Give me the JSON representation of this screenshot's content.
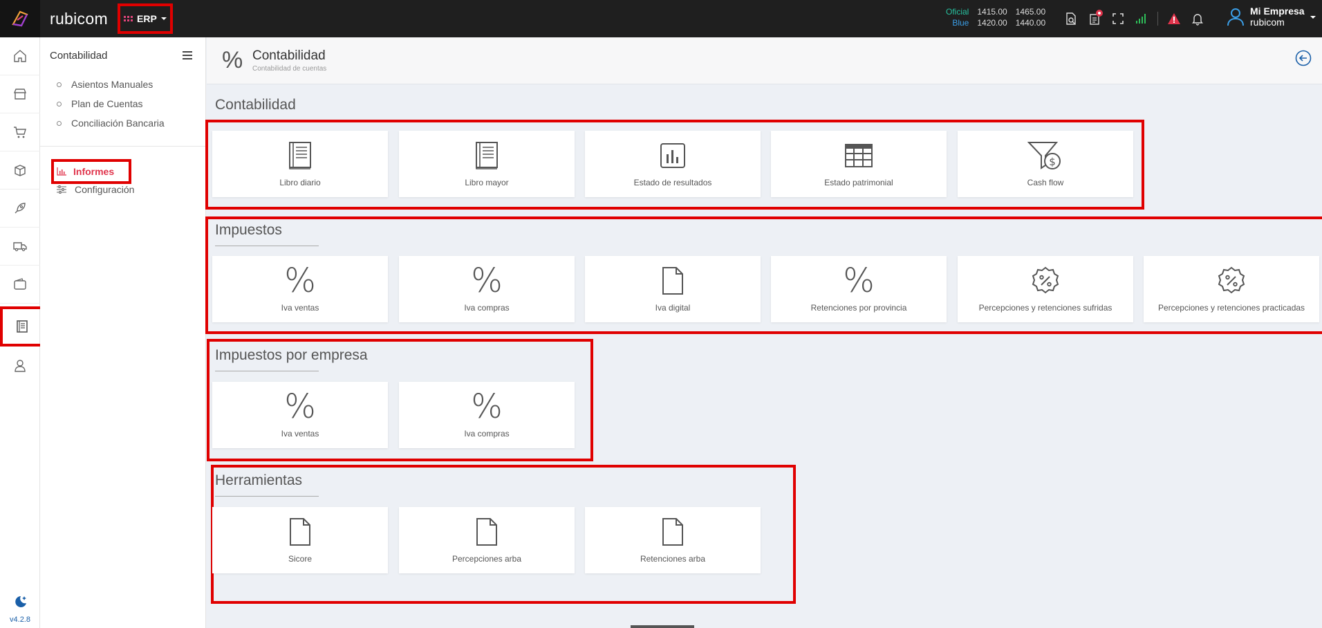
{
  "topbar": {
    "brand": "rubicom",
    "module": "ERP",
    "rates": [
      {
        "label": "Oficial",
        "buy": "1415.00",
        "sell": "1465.00"
      },
      {
        "label": "Blue",
        "buy": "1420.00",
        "sell": "1440.00"
      }
    ],
    "user": {
      "name": "Mi Empresa",
      "company": "rubicom"
    }
  },
  "rail": {
    "version": "v4.2.8"
  },
  "submenu": {
    "title": "Contabilidad",
    "items": [
      "Asientos Manuales",
      "Plan de Cuentas",
      "Conciliación Bancaria"
    ],
    "informes": "Informes",
    "config": "Configuración"
  },
  "header": {
    "title": "Contabilidad",
    "subtitle": "Contabilidad de cuentas"
  },
  "sections": {
    "contabilidad": {
      "title": "Contabilidad",
      "cards": [
        "Libro diario",
        "Libro mayor",
        "Estado de resultados",
        "Estado patrimonial",
        "Cash flow"
      ]
    },
    "impuestos": {
      "title": "Impuestos",
      "cards": [
        "Iva ventas",
        "Iva compras",
        "Iva digital",
        "Retenciones por provincia",
        "Percepciones y retenciones sufridas",
        "Percepciones y retenciones practicadas"
      ]
    },
    "impuestos_empresa": {
      "title": "Impuestos por empresa",
      "cards": [
        "Iva ventas",
        "Iva compras"
      ]
    },
    "herramientas": {
      "title": "Herramientas",
      "cards": [
        "Sicore",
        "Percepciones arba",
        "Retenciones arba"
      ]
    }
  },
  "colors": {
    "highlight": "#e00000",
    "accent": "#e0334b",
    "link": "#1a5fa8"
  }
}
